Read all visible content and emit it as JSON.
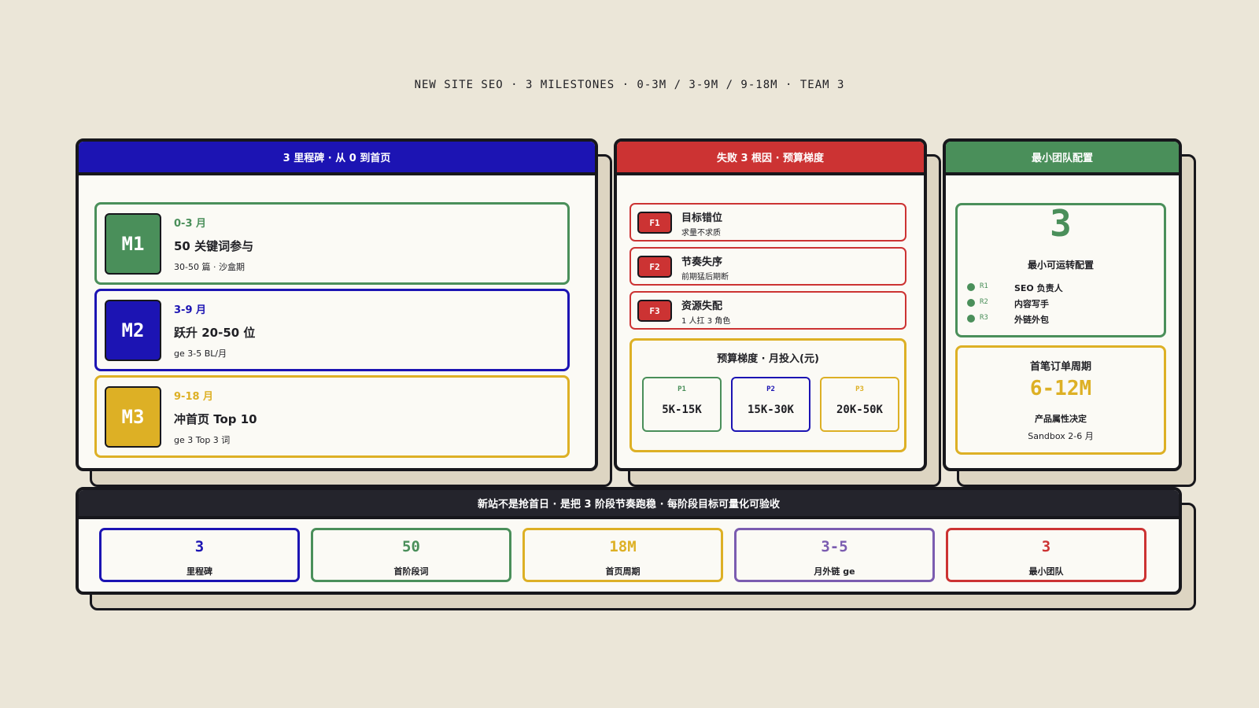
{
  "header": {
    "title": "NEW SITE SEO · 3 MILESTONES · 0-3M / 3-9M / 9-18M · TEAM 3"
  },
  "colors": {
    "blue": "#1c14b3",
    "red": "#cc3333",
    "green": "#4a8f5a",
    "yellow": "#ddb025",
    "purple": "#7b5cb0",
    "dark": "#24242c"
  },
  "milestones_panel": {
    "title": "3 里程碑 · 从 0 到首页",
    "items": [
      {
        "badge": "M1",
        "range": "0-3 月",
        "title": "50 关键词参与",
        "sub": "30-50 篇 · 沙盒期"
      },
      {
        "badge": "M2",
        "range": "3-9 月",
        "title": "跃升 20-50 位",
        "sub": "ge 3-5 BL/月"
      },
      {
        "badge": "M3",
        "range": "9-18 月",
        "title": "冲首页 Top 10",
        "sub": "ge 3 Top 3 词"
      }
    ]
  },
  "failure_panel": {
    "title": "失败 3 根因 · 预算梯度",
    "items": [
      {
        "tag": "F1",
        "title": "目标错位",
        "sub": "求量不求质"
      },
      {
        "tag": "F2",
        "title": "节奏失序",
        "sub": "前期猛后期断"
      },
      {
        "tag": "F3",
        "title": "资源失配",
        "sub": "1 人扛 3 角色"
      }
    ],
    "budget": {
      "title": "预算梯度 · 月投入(元)",
      "tiers": [
        {
          "label": "P1",
          "value": "5K-15K"
        },
        {
          "label": "P2",
          "value": "15K-30K"
        },
        {
          "label": "P3",
          "value": "20K-50K"
        }
      ]
    }
  },
  "team_panel": {
    "title": "最小团队配置",
    "count": "3",
    "caption": "最小可运转配置",
    "roles": [
      {
        "label": "R1",
        "name": "SEO 负责人"
      },
      {
        "label": "R2",
        "name": "内容写手"
      },
      {
        "label": "R3",
        "name": "外链外包"
      }
    ],
    "order": {
      "title": "首笔订单周期",
      "value": "6-12M",
      "line1": "产品属性决定",
      "line2": "Sandbox 2-6 月"
    }
  },
  "summary_panel": {
    "title": "新站不是抢首日 · 是把 3 阶段节奏跑稳 · 每阶段目标可量化可验收",
    "stats": [
      {
        "value": "3",
        "label": "里程碑"
      },
      {
        "value": "50",
        "label": "首阶段词"
      },
      {
        "value": "18M",
        "label": "首页周期"
      },
      {
        "value": "3-5",
        "label": "月外链 ge"
      },
      {
        "value": "3",
        "label": "最小团队"
      }
    ]
  }
}
